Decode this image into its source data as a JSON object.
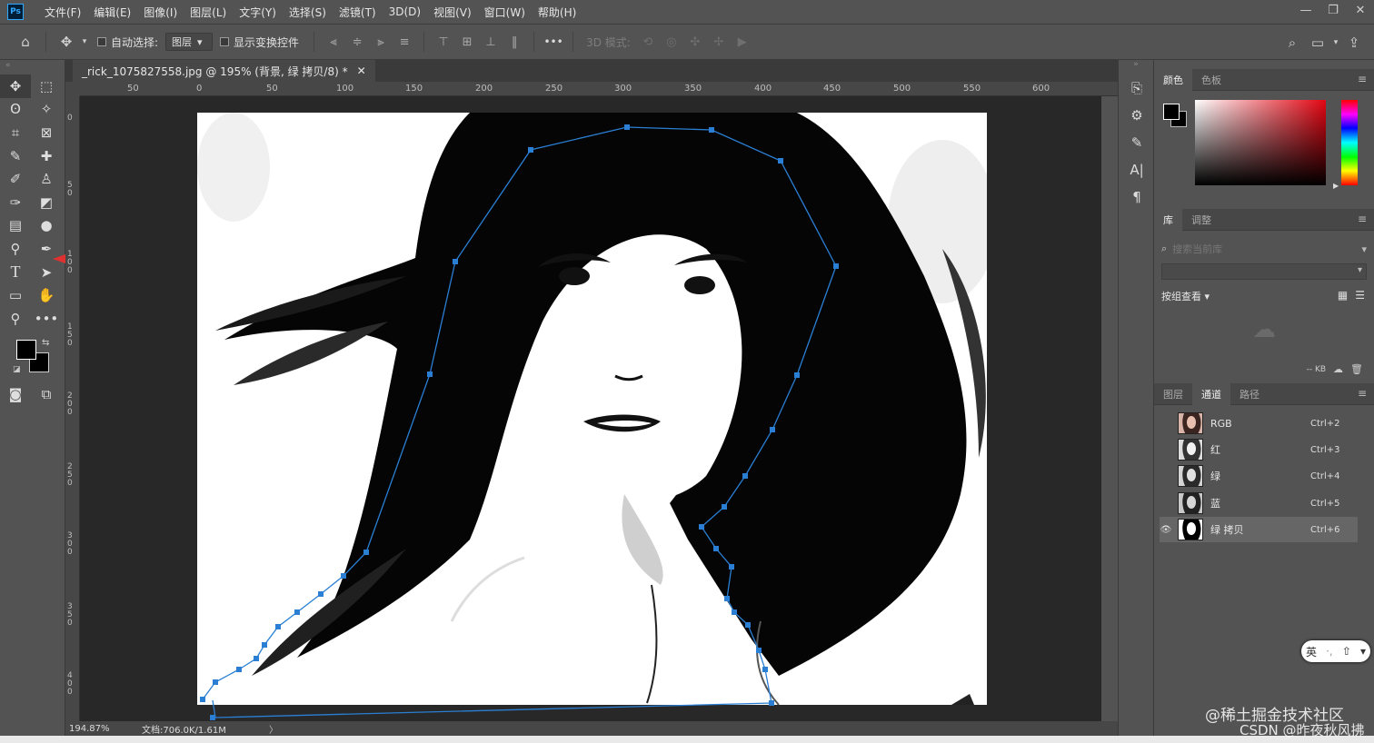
{
  "app": {
    "logo": "Ps",
    "menu": [
      "文件(F)",
      "编辑(E)",
      "图像(I)",
      "图层(L)",
      "文字(Y)",
      "选择(S)",
      "滤镜(T)",
      "3D(D)",
      "视图(V)",
      "窗口(W)",
      "帮助(H)"
    ],
    "window_controls": [
      "—",
      "❐",
      "✕"
    ]
  },
  "options": {
    "auto_select_label": "自动选择:",
    "auto_select_value": "图层",
    "show_transform_label": "显示变换控件",
    "mode_3d_label": "3D 模式:",
    "more": "•••"
  },
  "document": {
    "tab_title": "_rick_1075827558.jpg @ 195% (背景, 绿 拷贝/8) *",
    "tab_close": "✕",
    "zoom": "194.87%",
    "doc_size": "文档:706.0K/1.61M",
    "status_arrow": "〉"
  },
  "ruler": {
    "h_ticks": [
      "50",
      "0",
      "50",
      "100",
      "150",
      "200",
      "250",
      "300",
      "350",
      "400",
      "450",
      "500",
      "550",
      "600"
    ],
    "v_ticks": [
      "0",
      "5 0",
      "1 0 0",
      "1 5 0",
      "2 0 0",
      "2 5 0",
      "3 0 0",
      "3 5 0",
      "4 0 0"
    ]
  },
  "color_panel": {
    "tabs": [
      "颜色",
      "色板"
    ],
    "foreground": "#000000",
    "background": "#000000"
  },
  "library_panel": {
    "tabs": [
      "库",
      "调整"
    ],
    "search_placeholder": "搜索当前库",
    "group_view": "按组查看",
    "size": "-- KB"
  },
  "channels_panel": {
    "tabs": [
      "图层",
      "通道",
      "路径"
    ],
    "channels": [
      {
        "name": "RGB",
        "shortcut": "Ctrl+2",
        "visible": false
      },
      {
        "name": "红",
        "shortcut": "Ctrl+3",
        "visible": false
      },
      {
        "name": "绿",
        "shortcut": "Ctrl+4",
        "visible": false
      },
      {
        "name": "蓝",
        "shortcut": "Ctrl+5",
        "visible": false
      },
      {
        "name": "绿 拷贝",
        "shortcut": "Ctrl+6",
        "visible": true
      }
    ]
  },
  "watermark": {
    "line1": "@稀土掘金技术社区",
    "line2": "CSDN @昨夜秋风拂"
  },
  "ime": {
    "lang": "英"
  },
  "colors": {
    "path_stroke": "#2a7fd4",
    "accent_arrow": "#e03030"
  }
}
